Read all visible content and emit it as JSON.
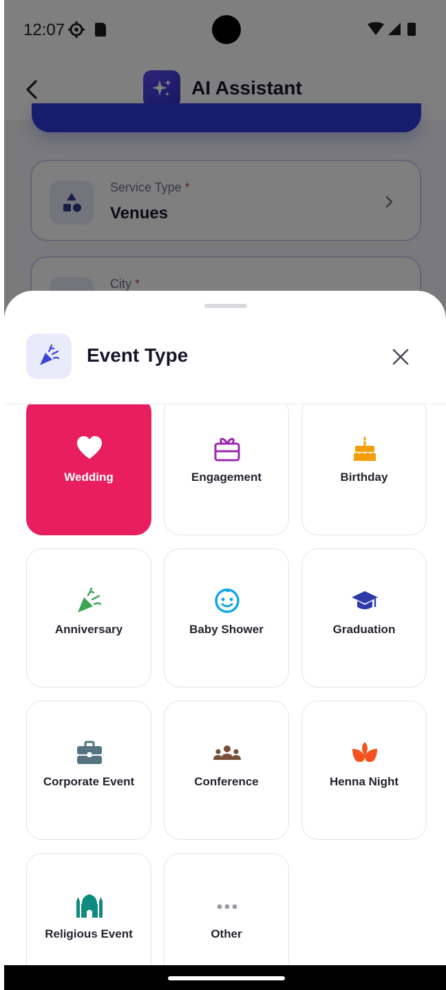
{
  "status_bar": {
    "time": "12:07"
  },
  "app_bar": {
    "title": "AI Assistant"
  },
  "form": {
    "service_type": {
      "label": "Service Type",
      "required_mark": "*",
      "value": "Venues"
    },
    "city": {
      "label": "City",
      "required_mark": "*"
    }
  },
  "sheet": {
    "title": "Event Type",
    "selected": "Wedding",
    "options": [
      {
        "label": "Wedding",
        "icon": "heart-icon",
        "color": "#ffffff"
      },
      {
        "label": "Engagement",
        "icon": "gift-icon",
        "color": "#9c27b0"
      },
      {
        "label": "Birthday",
        "icon": "birthday-cake-icon",
        "color": "#f59e0b"
      },
      {
        "label": "Anniversary",
        "icon": "party-popper-icon",
        "color": "#3aa655"
      },
      {
        "label": "Baby Shower",
        "icon": "baby-face-icon",
        "color": "#0ea5e9"
      },
      {
        "label": "Graduation",
        "icon": "graduation-cap-icon",
        "color": "#2e3aa8"
      },
      {
        "label": "Corporate Event",
        "icon": "briefcase-icon",
        "color": "#547481"
      },
      {
        "label": "Conference",
        "icon": "people-group-icon",
        "color": "#7a4f3a"
      },
      {
        "label": "Henna Night",
        "icon": "lotus-icon",
        "color": "#f4511e"
      },
      {
        "label": "Religious Event",
        "icon": "mosque-icon",
        "color": "#0f8a7e"
      },
      {
        "label": "Other",
        "icon": "more-dots-icon",
        "color": "#9a9aa6"
      }
    ]
  },
  "colors": {
    "accent": "#3038d8",
    "selected": "#e91e5f",
    "required": "#e23b3b"
  }
}
